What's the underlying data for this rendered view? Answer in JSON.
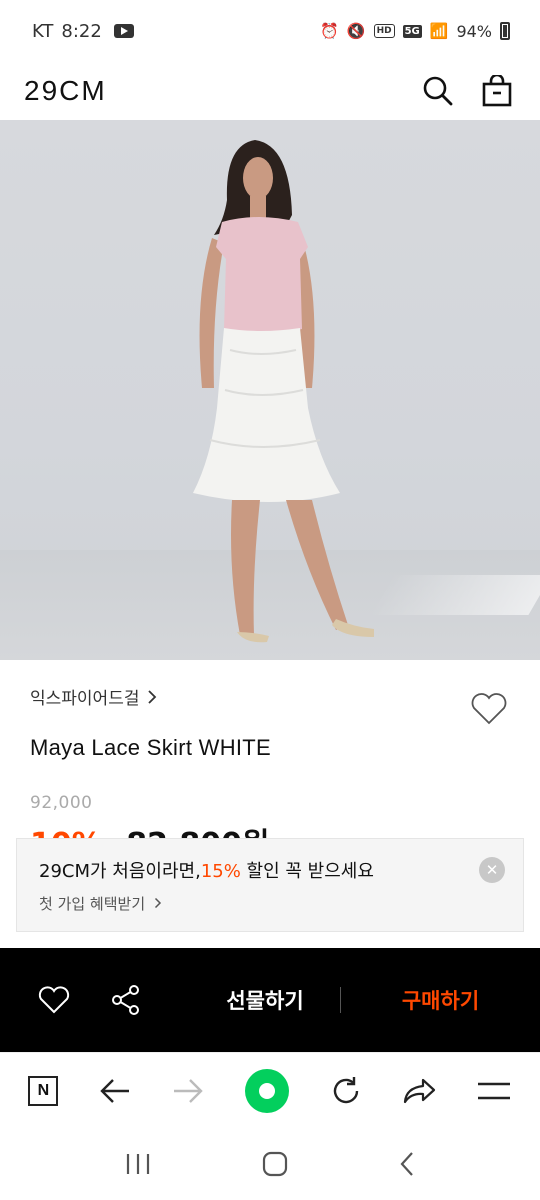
{
  "status": {
    "carrier": "KT",
    "time": "8:22",
    "network": "5G",
    "battery": "94%"
  },
  "header": {
    "logo": "29CM"
  },
  "product": {
    "brand": "익스파이어드걸",
    "name": "Maya Lace Skirt WHITE",
    "original_price": "92,000",
    "discount": "10%",
    "sale_price": "82,800원"
  },
  "coupon": {
    "title_prefix": "29CM가 처음이라면,",
    "title_highlight": "15%",
    "title_suffix": " 할인 꼭 받으세요",
    "subtitle": "첫 가입 혜택받기"
  },
  "buy_bar": {
    "gift_label": "선물하기",
    "purchase_label": "구매하기"
  },
  "colors": {
    "accent": "#ff4800",
    "browser_green": "#03cf5d"
  }
}
